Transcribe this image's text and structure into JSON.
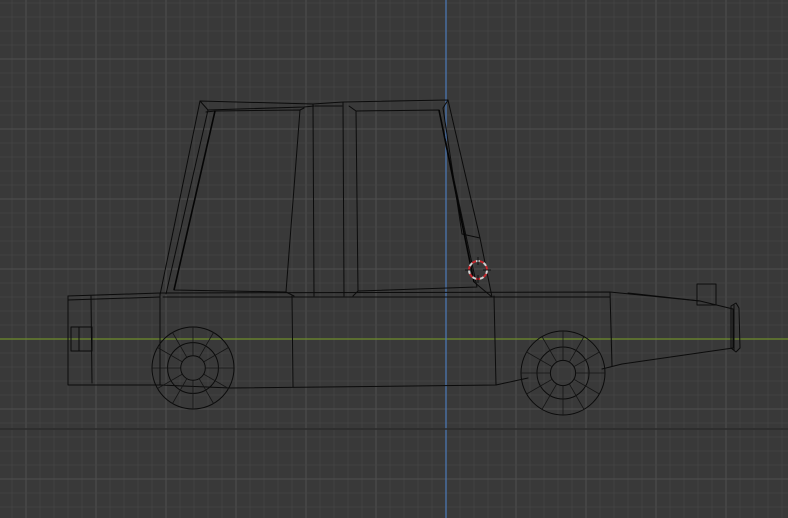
{
  "viewport": {
    "view": "orthographic-side",
    "background_color": "#393939",
    "grid_minor_color": "#444444",
    "grid_major_color": "#4c4c4c",
    "x_axis_color": "#6b8a2a",
    "z_axis_color": "#4a78b8",
    "wire_color": "#0b0b0b",
    "cursor_colors": [
      "#d0d0d0",
      "#c8282e"
    ]
  },
  "object": {
    "type": "car-wireframe",
    "parts": [
      "cabin",
      "front-window",
      "rear-window",
      "body",
      "front-wheel",
      "rear-wheel",
      "headlight",
      "bumper",
      "tail-light"
    ]
  },
  "tools": {
    "cursor_icon": "3d-cursor-icon"
  }
}
